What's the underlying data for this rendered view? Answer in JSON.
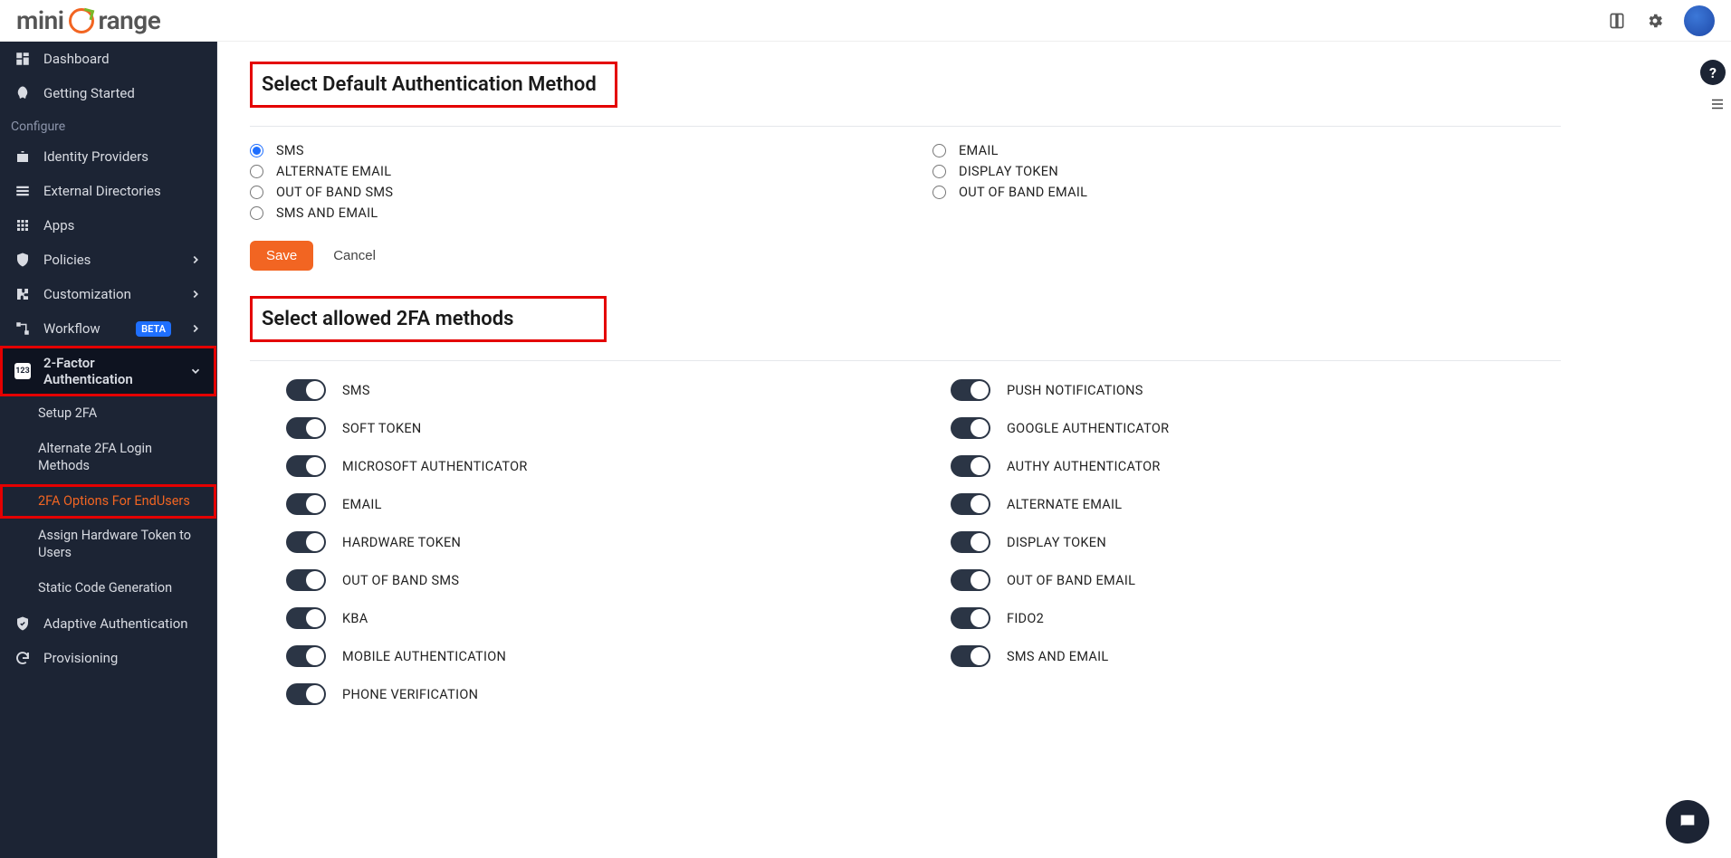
{
  "brand": {
    "prefix": "mini",
    "suffix": "range"
  },
  "sidebar": {
    "dashboard": "Dashboard",
    "getting_started": "Getting Started",
    "configure_label": "Configure",
    "identity_providers": "Identity Providers",
    "external_directories": "External Directories",
    "apps": "Apps",
    "policies": "Policies",
    "customization": "Customization",
    "workflow": "Workflow",
    "workflow_badge": "BETA",
    "two_factor": "2-Factor Authentication",
    "sub": {
      "setup": "Setup 2FA",
      "alternate": "Alternate 2FA Login Methods",
      "options": "2FA Options For EndUsers",
      "assign": "Assign Hardware Token to Users",
      "static": "Static Code Generation"
    },
    "adaptive": "Adaptive Authentication",
    "provisioning": "Provisioning"
  },
  "main": {
    "heading1": "Select Default Authentication Method",
    "heading2": "Select allowed 2FA methods",
    "radios_left": [
      "SMS",
      "ALTERNATE EMAIL",
      "OUT OF BAND SMS",
      "SMS AND EMAIL"
    ],
    "radios_right": [
      "EMAIL",
      "DISPLAY TOKEN",
      "OUT OF BAND EMAIL"
    ],
    "save": "Save",
    "cancel": "Cancel",
    "toggles_left": [
      "SMS",
      "SOFT TOKEN",
      "MICROSOFT AUTHENTICATOR",
      "EMAIL",
      "HARDWARE TOKEN",
      "OUT OF BAND SMS",
      "KBA",
      "MOBILE AUTHENTICATION",
      "PHONE VERIFICATION"
    ],
    "toggles_right": [
      "PUSH NOTIFICATIONS",
      "GOOGLE AUTHENTICATOR",
      "AUTHY AUTHENTICATOR",
      "ALTERNATE EMAIL",
      "DISPLAY TOKEN",
      "OUT OF BAND EMAIL",
      "FIDO2",
      "SMS AND EMAIL"
    ]
  }
}
